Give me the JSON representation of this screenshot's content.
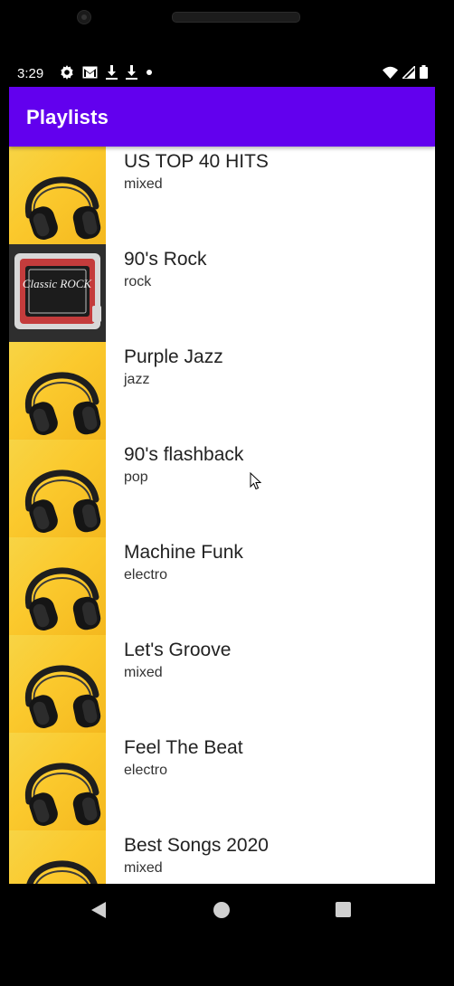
{
  "status_bar": {
    "time": "3:29",
    "icons_left": [
      "settings-icon",
      "gmail-icon",
      "download-icon",
      "download-icon",
      "dot-icon"
    ],
    "icons_right": [
      "wifi-icon",
      "signal-icon",
      "battery-icon"
    ]
  },
  "app_bar": {
    "title": "Playlists",
    "color": "#6200EE"
  },
  "playlists": [
    {
      "title": "US TOP 40 HITS",
      "genre": "mixed",
      "thumbnail": "headphones-image"
    },
    {
      "title": "90's Rock",
      "genre": "rock",
      "thumbnail": "classic-rock-image",
      "thumbnail_text": "Classic ROCK"
    },
    {
      "title": "Purple Jazz",
      "genre": "jazz",
      "thumbnail": "headphones-image"
    },
    {
      "title": "90's flashback",
      "genre": "pop",
      "thumbnail": "headphones-image"
    },
    {
      "title": "Machine Funk",
      "genre": "electro",
      "thumbnail": "headphones-image"
    },
    {
      "title": "Let's Groove",
      "genre": "mixed",
      "thumbnail": "headphones-image"
    },
    {
      "title": "Feel The Beat",
      "genre": "electro",
      "thumbnail": "headphones-image"
    },
    {
      "title": "Best Songs 2020",
      "genre": "mixed",
      "thumbnail": "headphones-image"
    }
  ],
  "nav_bar": {
    "buttons": [
      "back-icon",
      "home-icon",
      "recents-icon"
    ]
  }
}
